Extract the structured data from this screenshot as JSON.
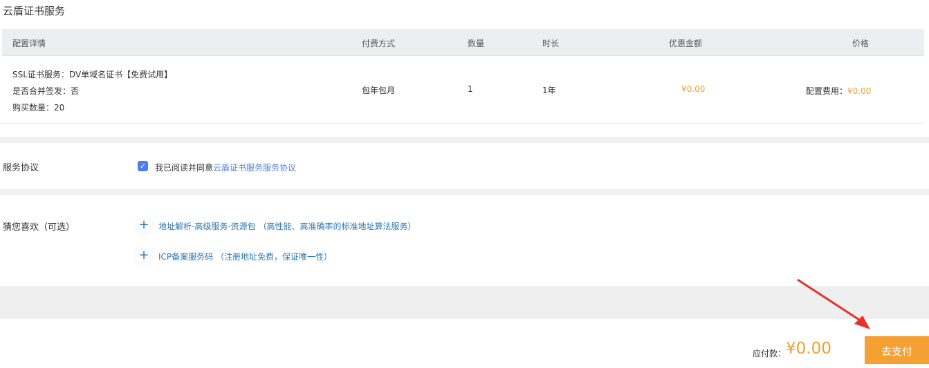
{
  "title": "云盾证书服务",
  "table": {
    "headers": [
      "配置详情",
      "付费方式",
      "数量",
      "时长",
      "优惠金额",
      "价格"
    ],
    "row": {
      "detail": [
        "SSL证书服务：DV单域名证书【免费试用】",
        "是否合并签发：否",
        "购买数量：20"
      ],
      "pay_type": "包年包月",
      "quantity": "1",
      "duration": "1年",
      "discount": "¥0.00",
      "price_label": "配置费用：",
      "price": "¥0.00"
    }
  },
  "agreement": {
    "label": "服务协议",
    "text": "我已阅读并同意",
    "link": "云盾证书服务服务协议",
    "checked": true
  },
  "recommend": {
    "label": "猜您喜欢（可选）",
    "items": [
      {
        "name": "地址解析-高级服务-资源包",
        "desc": "（高性能、高准确率的标准地址算法服务）"
      },
      {
        "name": "ICP备案服务码",
        "desc": "（注册地址免费，保证唯一性）"
      }
    ]
  },
  "footer": {
    "due_label": "应付款：",
    "amount": "¥0.00",
    "pay_button": "去支付"
  }
}
